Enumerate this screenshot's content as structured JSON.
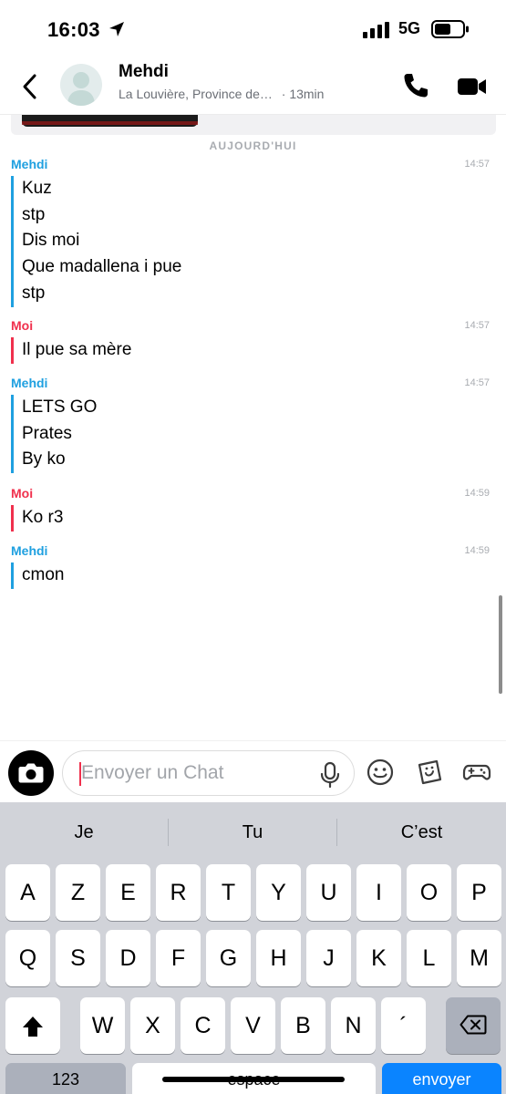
{
  "status_bar": {
    "time": "16:03",
    "network": "5G"
  },
  "header": {
    "contact_name": "Mehdi",
    "location": "La Louvière, Province de…",
    "last_seen": "· 13min"
  },
  "day_separator": "AUJOURD'HUI",
  "messages": [
    {
      "sender": "Mehdi",
      "time": "14:57",
      "lines": [
        "Kuz",
        "stp",
        "Dis moi",
        "Que madallena i pue",
        "stp"
      ]
    },
    {
      "sender": "Moi",
      "time": "14:57",
      "lines": [
        "Il pue sa mère"
      ]
    },
    {
      "sender": "Mehdi",
      "time": "14:57",
      "lines": [
        "LETS GO",
        "Prates",
        "By ko"
      ]
    },
    {
      "sender": "Moi",
      "time": "14:59",
      "lines": [
        "Ko r3"
      ]
    },
    {
      "sender": "Mehdi",
      "time": "14:59",
      "lines": [
        "cmon"
      ]
    }
  ],
  "composer": {
    "placeholder": "Envoyer un Chat"
  },
  "keyboard": {
    "suggestions": [
      "Je",
      "Tu",
      "C’est"
    ],
    "row1": [
      "A",
      "Z",
      "E",
      "R",
      "T",
      "Y",
      "U",
      "I",
      "O",
      "P"
    ],
    "row2": [
      "Q",
      "S",
      "D",
      "F",
      "G",
      "H",
      "J",
      "K",
      "L",
      "M"
    ],
    "row3": [
      "W",
      "X",
      "C",
      "V",
      "B",
      "N",
      "´"
    ],
    "numbers_label": "123",
    "space_label": "espace",
    "send_label": "envoyer"
  },
  "colors": {
    "friend": "#1fa0e0",
    "self": "#f0304d",
    "send_key": "#0a84ff"
  }
}
